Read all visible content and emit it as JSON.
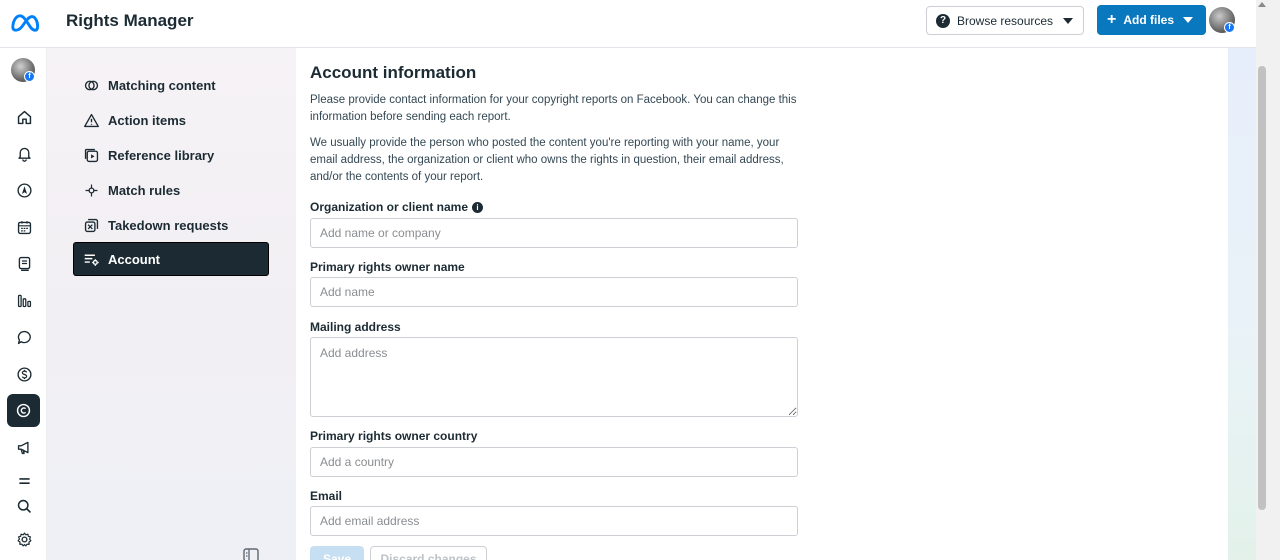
{
  "header": {
    "app_title": "Rights Manager",
    "browse_label": "Browse resources",
    "add_files_label": "Add files",
    "fb_badge": "f"
  },
  "rail": {
    "items": [
      "home-icon",
      "bell-icon",
      "compass-icon",
      "calendar-icon",
      "content-icon",
      "insights-icon",
      "chat-icon",
      "dollar-icon",
      "copyright-icon",
      "megaphone-icon",
      "menu-icon",
      "search-icon",
      "settings-icon"
    ],
    "active": "copyright-icon"
  },
  "sidebar": {
    "items": [
      {
        "label": "Matching content",
        "icon": "matching-icon"
      },
      {
        "label": "Action items",
        "icon": "warning-icon"
      },
      {
        "label": "Reference library",
        "icon": "library-icon"
      },
      {
        "label": "Match rules",
        "icon": "rules-icon"
      },
      {
        "label": "Takedown requests",
        "icon": "takedown-icon"
      },
      {
        "label": "Account",
        "icon": "account-settings-icon",
        "active": true
      }
    ]
  },
  "main": {
    "title": "Account information",
    "paragraph1": "Please provide contact information for your copyright reports on Facebook. You can change this information before sending each report.",
    "paragraph2": "We usually provide the person who posted the content you're reporting with your name, your email address, the organization or client who owns the rights in question, their email address, and/or the contents of your report.",
    "fields": {
      "org": {
        "label": "Organization or client name",
        "placeholder": "Add name or company",
        "value": ""
      },
      "owner": {
        "label": "Primary rights owner name",
        "placeholder": "Add name",
        "value": ""
      },
      "address": {
        "label": "Mailing address",
        "placeholder": "Add address",
        "value": ""
      },
      "country": {
        "label": "Primary rights owner country",
        "placeholder": "Add a country",
        "value": ""
      },
      "email": {
        "label": "Email",
        "placeholder": "Add email address",
        "value": ""
      }
    },
    "save_label": "Save",
    "discard_label": "Discard changes"
  },
  "colors": {
    "primary": "#0a78be",
    "dark": "#1c2b33",
    "facebook_blue": "#1877f2"
  }
}
